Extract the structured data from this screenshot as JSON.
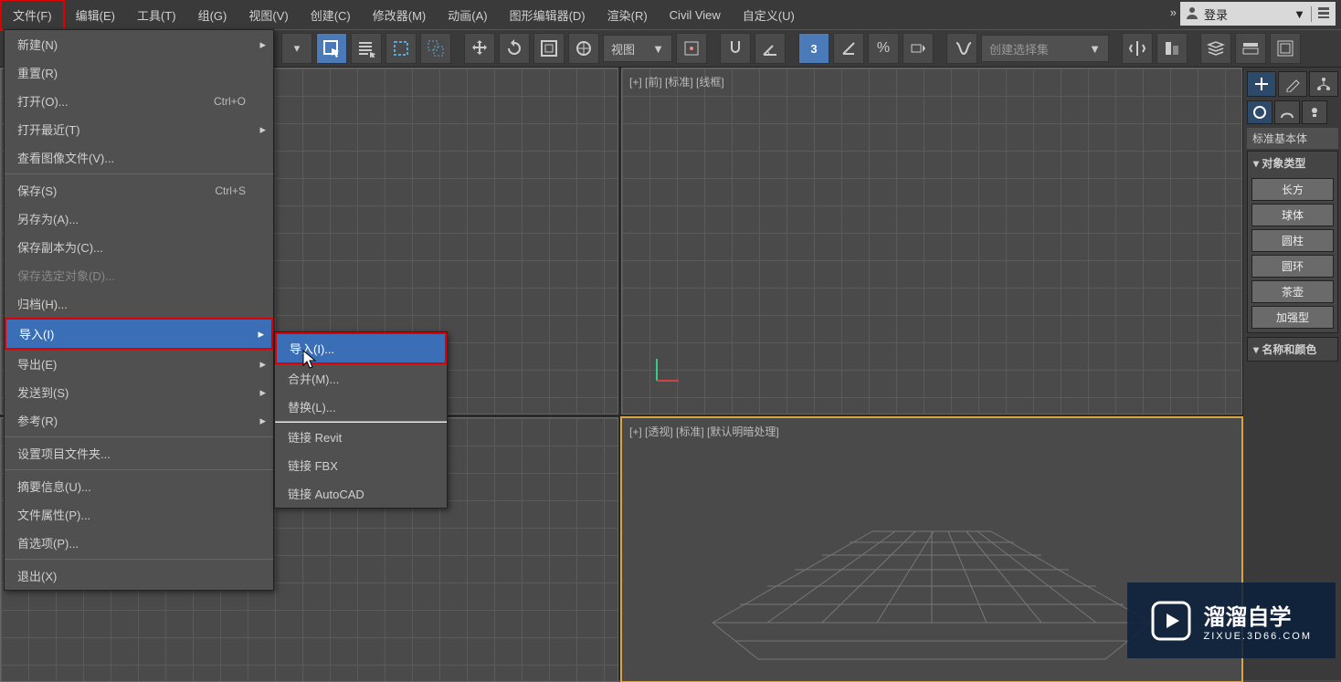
{
  "menubar": {
    "file": "文件(F)",
    "edit": "编辑(E)",
    "tools": "工具(T)",
    "group": "组(G)",
    "views": "视图(V)",
    "create": "创建(C)",
    "modifiers": "修改器(M)",
    "animation": "动画(A)",
    "graph_editors": "图形编辑器(D)",
    "rendering": "渲染(R)",
    "civil_view": "Civil View",
    "customize": "自定义(U)"
  },
  "login": {
    "label": "登录"
  },
  "toolbar": {
    "viewport_mode": "视图",
    "selection_set_placeholder": "创建选择集"
  },
  "viewports": {
    "top_right": "[+] [前] [标准] [线框]",
    "bottom_right": "[+] [透视] [标准] [默认明暗处理]"
  },
  "file_menu": {
    "new": "新建(N)",
    "reset": "重置(R)",
    "open": "打开(O)...",
    "open_shortcut": "Ctrl+O",
    "open_recent": "打开最近(T)",
    "view_image": "查看图像文件(V)...",
    "save": "保存(S)",
    "save_shortcut": "Ctrl+S",
    "save_as": "另存为(A)...",
    "save_copy_as": "保存副本为(C)...",
    "save_selected": "保存选定对象(D)...",
    "archive": "归档(H)...",
    "import": "导入(I)",
    "export": "导出(E)",
    "send_to": "发送到(S)",
    "reference": "参考(R)",
    "project": "设置项目文件夹...",
    "summary": "摘要信息(U)...",
    "file_props": "文件属性(P)...",
    "preferences": "首选项(P)...",
    "exit": "退出(X)"
  },
  "import_submenu": {
    "import": "导入(I)...",
    "merge": "合并(M)...",
    "replace": "替换(L)...",
    "link_revit": "链接 Revit",
    "link_fbx": "链接 FBX",
    "link_autocad": "链接 AutoCAD"
  },
  "side": {
    "category": "标准基本体",
    "rollout_objtype": "对象类型",
    "rollout_name": "名称和颜色",
    "btns": {
      "box": "长方",
      "sphere": "球体",
      "cylinder": "圆柱",
      "torus": "圆环",
      "teapot": "茶壶",
      "plane": "加强型"
    }
  },
  "watermark": {
    "title": "溜溜自学",
    "url": "ZIXUE.3D66.COM"
  }
}
